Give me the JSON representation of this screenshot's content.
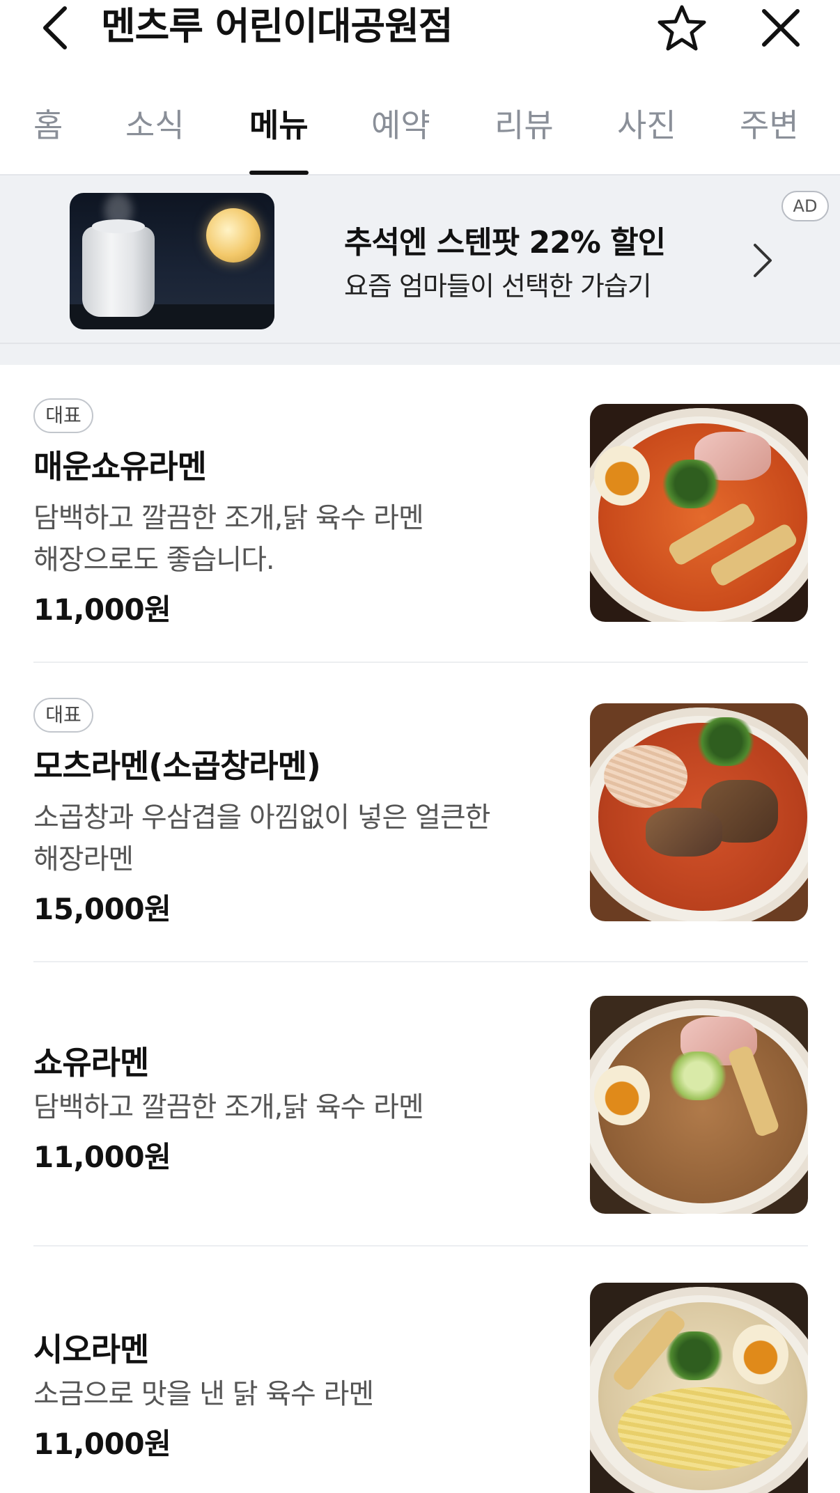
{
  "header": {
    "title": "멘츠루 어린이대공원점",
    "back_icon": "chevron-left-icon",
    "favorite_icon": "star-outline-icon",
    "close_icon": "close-icon"
  },
  "tabs": [
    {
      "label": "홈",
      "active": false
    },
    {
      "label": "소식",
      "active": false
    },
    {
      "label": "메뉴",
      "active": true
    },
    {
      "label": "예약",
      "active": false
    },
    {
      "label": "리뷰",
      "active": false
    },
    {
      "label": "사진",
      "active": false
    },
    {
      "label": "주변",
      "active": false
    }
  ],
  "ad": {
    "badge": "AD",
    "title": "추석엔 스텐팟 22% 할인",
    "subtitle": "요즘 엄마들이 선택한 가습기",
    "image": "humidifier-moon-image",
    "chevron_icon": "chevron-right-icon"
  },
  "menu": [
    {
      "badge": "대표",
      "name": "매운쇼유라멘",
      "description": "담백하고 깔끔한 조개,닭 육수 라멘 해장으로도 좋습니다.",
      "price": "11,000원",
      "image": "spicy-shoyu-ramen-photo"
    },
    {
      "badge": "대표",
      "name": "모츠라멘(소곱창라멘)",
      "description": "소곱창과 우삼겹을 아낌없이 넣은 얼큰한 해장라멘",
      "price": "15,000원",
      "image": "motsu-ramen-photo"
    },
    {
      "badge": "",
      "name": "쇼유라멘",
      "description": "담백하고 깔끔한 조개,닭 육수 라멘",
      "price": "11,000원",
      "image": "shoyu-ramen-photo"
    },
    {
      "badge": "",
      "name": "시오라멘",
      "description": "소금으로 맛을 낸 닭 육수 라멘",
      "price": "11,000원",
      "image": "shio-ramen-photo"
    }
  ]
}
